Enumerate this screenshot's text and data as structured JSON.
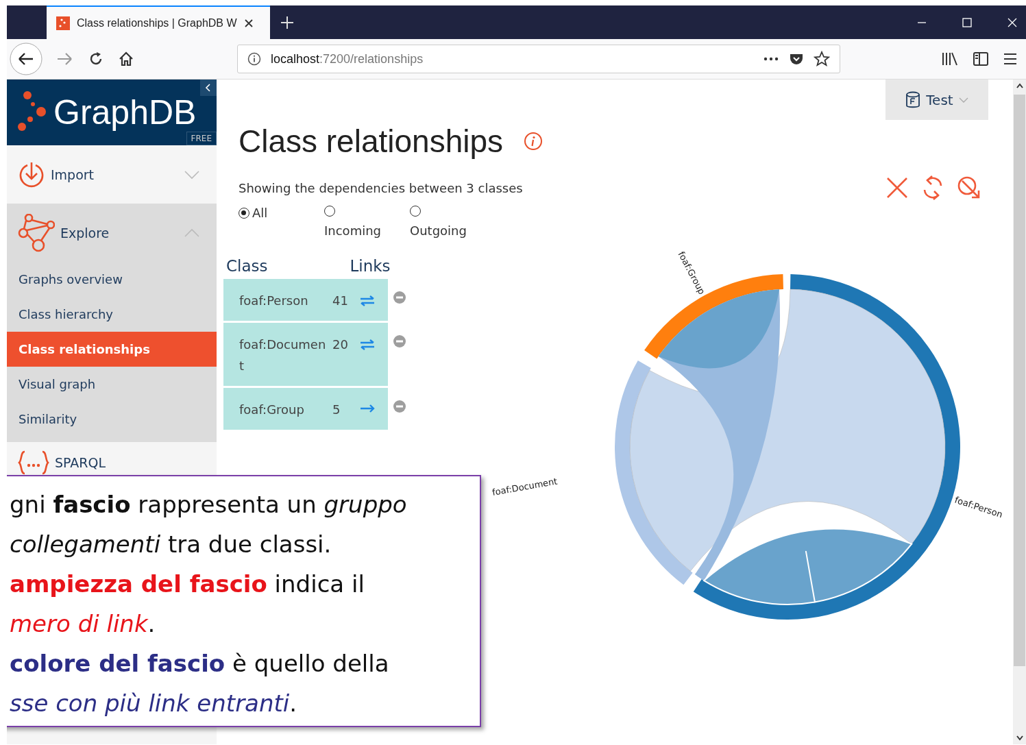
{
  "browser": {
    "tab": {
      "title": "Class relationships | GraphDB W",
      "selected": true
    },
    "address": {
      "host": "localhost",
      "path": ":7200/relationships"
    }
  },
  "sidebar": {
    "logo": "GraphDB",
    "edition": "FREE",
    "items": [
      {
        "label": "Import",
        "kind": "import",
        "expanded": false
      },
      {
        "label": "Explore",
        "kind": "explore",
        "expanded": true,
        "children": [
          {
            "label": "Graphs overview",
            "selected": false
          },
          {
            "label": "Class hierarchy",
            "selected": false
          },
          {
            "label": "Class relationships",
            "selected": true
          },
          {
            "label": "Visual graph",
            "selected": false
          },
          {
            "label": "Similarity",
            "selected": false
          }
        ]
      },
      {
        "label": "SPARQL",
        "kind": "sparql",
        "expanded": false
      }
    ]
  },
  "repository": {
    "label": "Test"
  },
  "page": {
    "title": "Class relationships",
    "subtitle": "Showing the dependencies between 3 classes",
    "filters": [
      {
        "label": "All",
        "selected": true
      },
      {
        "label": "Incoming",
        "selected": false
      },
      {
        "label": "Outgoing",
        "selected": false
      }
    ],
    "table": {
      "columns": [
        "Class",
        "Links"
      ],
      "rows": [
        {
          "class": "foaf:Person",
          "links": "41",
          "kind": "both"
        },
        {
          "class": "foaf:Document",
          "links": "20",
          "kind": "both"
        },
        {
          "class": "foaf:Group",
          "links": "5",
          "kind": "out"
        }
      ]
    },
    "diagram_labels": [
      "foaf:Group",
      "foaf:Document",
      "foaf:Person"
    ]
  },
  "callout": {
    "lines": [
      {
        "text": "gni **fascio** rappresenta un *gruppo*",
        "kind": "plain"
      },
      {
        "text": "*collegamenti* tra due classi.",
        "kind": "plain"
      },
      {
        "text": "**ampiezza del fascio** indica il",
        "kind": "alert"
      },
      {
        "text": "*mero di link*.",
        "kind": "alert"
      },
      {
        "text": "**colore del fascio** è quello della",
        "kind": "key"
      },
      {
        "text": "*sse con più link entranti*.",
        "kind": "key"
      }
    ]
  }
}
